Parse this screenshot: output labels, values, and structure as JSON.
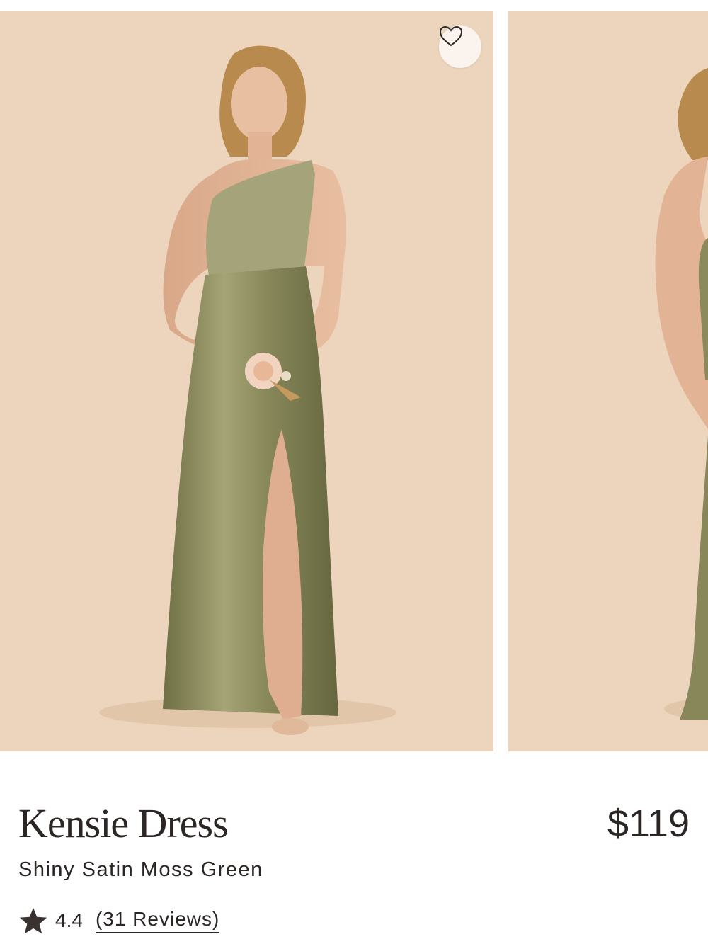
{
  "product": {
    "name": "Kensie Dress",
    "price": "$119",
    "variant": "Shiny Satin Moss Green",
    "rating": "4.4",
    "rating_value": 4.4,
    "reviews_link": "(31 Reviews)"
  },
  "gallery": {
    "images": [
      {
        "name": "front-view"
      },
      {
        "name": "back-view"
      }
    ]
  },
  "icons": {
    "favorite": "heart-outline-icon",
    "rating": "star-icon"
  },
  "colors": {
    "photo_background": "#ecd5bc",
    "dress": "#8a8a5c",
    "text": "#2b2524",
    "favorite_button_bg": "#fbf3ee"
  }
}
